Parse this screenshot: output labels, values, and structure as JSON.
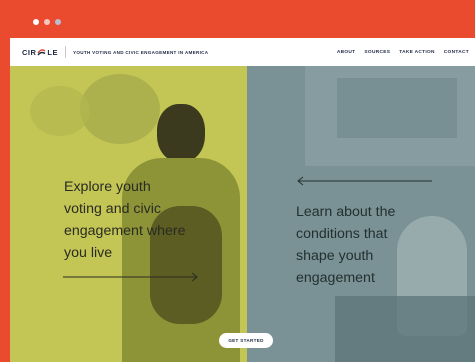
{
  "window_controls": {
    "colors": [
      "#ffffff",
      "#f6c6c0",
      "#b7bdd3"
    ]
  },
  "header": {
    "logo": "CIRCLE",
    "tagline": "YOUTH VOTING AND CIVIC ENGAGEMENT IN AMERICA",
    "nav": [
      "ABOUT",
      "SOURCES",
      "TAKE ACTION",
      "CONTACT"
    ]
  },
  "hero": {
    "left_lines": [
      "Explore youth",
      "voting and civic",
      "engagement where",
      "you live"
    ],
    "right_lines": [
      "Learn about the",
      "conditions that",
      "shape youth",
      "engagement"
    ],
    "cta_label": "GET STARTED"
  },
  "colors": {
    "frame": "#ea4b2e",
    "left_overlay": "#c3c555",
    "right_overlay": "#7a9296",
    "navy": "#1f2a44",
    "logo_red": "#d8432f"
  }
}
